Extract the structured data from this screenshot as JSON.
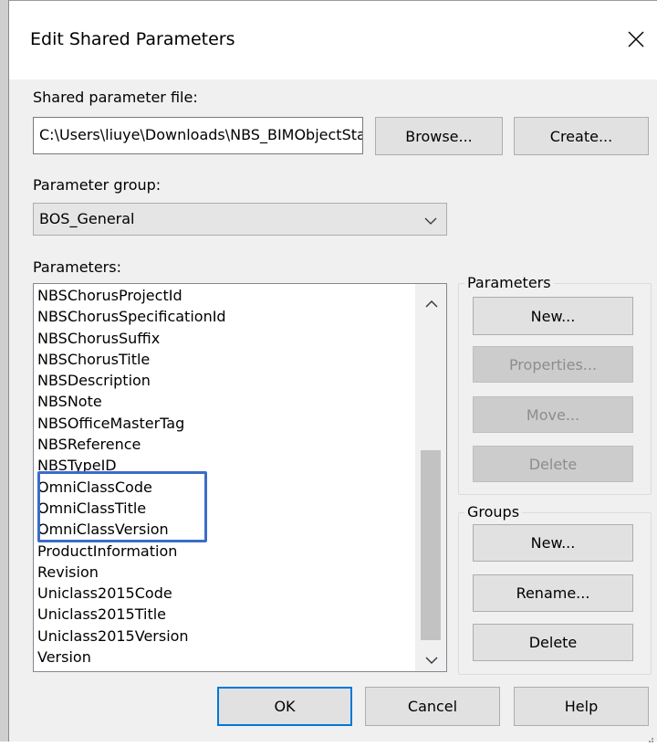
{
  "window": {
    "title": "Edit Shared Parameters"
  },
  "file": {
    "label": "Shared parameter file:",
    "path": "C:\\Users\\liuye\\Downloads\\NBS_BIMObjectStandard_SharedParameters.txt",
    "browse_label": "Browse...",
    "create_label": "Create..."
  },
  "group_select": {
    "label": "Parameter group:",
    "selected": "BOS_General"
  },
  "parameters": {
    "label": "Parameters:",
    "items": [
      "NBSChorusProjectId",
      "NBSChorusSpecificationId",
      "NBSChorusSuffix",
      "NBSChorusTitle",
      "NBSDescription",
      "NBSNote",
      "NBSOfficeMasterTag",
      "NBSReference",
      "NBSTypeID",
      "OmniClassCode",
      "OmniClassTitle",
      "OmniClassVersion",
      "ProductInformation",
      "Revision",
      "Uniclass2015Code",
      "Uniclass2015Title",
      "Uniclass2015Version",
      "Version"
    ]
  },
  "parameters_box": {
    "title": "Parameters",
    "new_label": "New...",
    "properties_label": "Properties...",
    "move_label": "Move...",
    "delete_label": "Delete"
  },
  "groups_box": {
    "title": "Groups",
    "new_label": "New...",
    "rename_label": "Rename...",
    "delete_label": "Delete"
  },
  "footer": {
    "ok_label": "OK",
    "cancel_label": "Cancel",
    "help_label": "Help"
  },
  "colors": {
    "highlight": "#3b6cc9",
    "default_button_border": "#0078d7"
  }
}
